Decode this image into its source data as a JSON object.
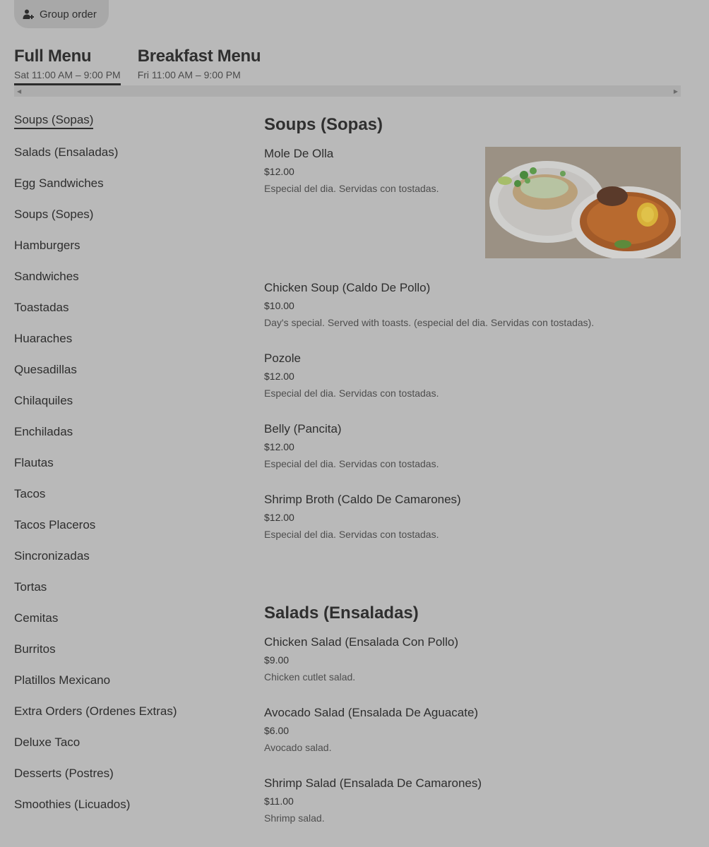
{
  "group_order": {
    "label": "Group order",
    "icon": "add-person-icon"
  },
  "menus": [
    {
      "title": "Full Menu",
      "hours": "Sat 11:00 AM – 9:00 PM",
      "active": true
    },
    {
      "title": "Breakfast Menu",
      "hours": "Fri 11:00 AM – 9:00 PM",
      "active": false
    }
  ],
  "categories": [
    "Soups (Sopas)",
    "Salads (Ensaladas)",
    "Egg Sandwiches",
    "Soups (Sopes)",
    "Hamburgers",
    "Sandwiches",
    "Toastadas",
    "Huaraches",
    "Quesadillas",
    "Chilaquiles",
    "Enchiladas",
    "Flautas",
    "Tacos",
    "Tacos Placeros",
    "Sincronizadas",
    "Tortas",
    "Cemitas",
    "Burritos",
    "Platillos Mexicano",
    "Extra Orders (Ordenes Extras)",
    "Deluxe Taco",
    "Desserts (Postres)",
    "Smoothies (Licuados)"
  ],
  "sections": [
    {
      "title": "Soups (Sopas)",
      "items": [
        {
          "name": "Mole De Olla",
          "price": "$12.00",
          "desc": "Especial del dia. Servidas con tostadas.",
          "has_photo": true
        },
        {
          "name": "Chicken Soup (Caldo De Pollo)",
          "price": "$10.00",
          "desc": "Day's special. Served with toasts. (especial del dia. Servidas con tostadas)."
        },
        {
          "name": "Pozole",
          "price": "$12.00",
          "desc": "Especial del dia. Servidas con tostadas."
        },
        {
          "name": "Belly (Pancita)",
          "price": "$12.00",
          "desc": "Especial del dia. Servidas con tostadas."
        },
        {
          "name": "Shrimp Broth (Caldo De Camarones)",
          "price": "$12.00",
          "desc": "Especial del dia. Servidas con tostadas."
        }
      ]
    },
    {
      "title": "Salads (Ensaladas)",
      "items": [
        {
          "name": "Chicken Salad (Ensalada Con Pollo)",
          "price": "$9.00",
          "desc": "Chicken cutlet salad."
        },
        {
          "name": "Avocado Salad (Ensalada De Aguacate)",
          "price": "$6.00",
          "desc": "Avocado salad."
        },
        {
          "name": "Shrimp Salad (Ensalada De Camarones)",
          "price": "$11.00",
          "desc": "Shrimp salad."
        }
      ]
    }
  ]
}
